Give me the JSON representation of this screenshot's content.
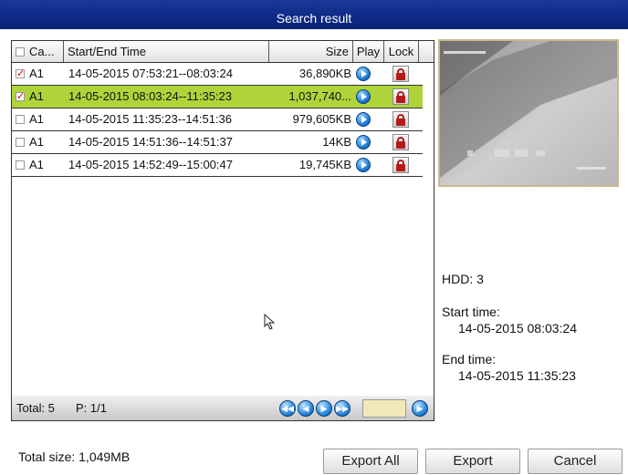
{
  "window": {
    "title": "Search result"
  },
  "table": {
    "headers": {
      "camera": "Ca...",
      "time": "Start/End Time",
      "size": "Size",
      "play": "Play",
      "lock": "Lock"
    },
    "rows": [
      {
        "checked": true,
        "camera": "A1",
        "time": "14-05-2015 07:53:21--08:03:24",
        "size": "36,890KB"
      },
      {
        "checked": true,
        "camera": "A1",
        "time": "14-05-2015 08:03:24--11:35:23",
        "size": "1,037,740..."
      },
      {
        "checked": false,
        "camera": "A1",
        "time": "14-05-2015 11:35:23--14:51:36",
        "size": "979,605KB"
      },
      {
        "checked": false,
        "camera": "A1",
        "time": "14-05-2015 14:51:36--14:51:37",
        "size": "14KB"
      },
      {
        "checked": false,
        "camera": "A1",
        "time": "14-05-2015 14:52:49--15:00:47",
        "size": "19,745KB"
      }
    ],
    "selected_row": 1
  },
  "footer": {
    "total": "Total: 5",
    "page": "P: 1/1"
  },
  "details": {
    "hdd": "HDD: 3",
    "start_label": "Start time:",
    "start_value": "14-05-2015 08:03:24",
    "end_label": "End time:",
    "end_value": "14-05-2015 11:35:23"
  },
  "bottom": {
    "total_size": "Total size: 1,049MB",
    "export_all": "Export All",
    "export": "Export",
    "cancel": "Cancel"
  },
  "colors": {
    "title_bar": "#0e2a86",
    "selected_row": "#aed43a",
    "page_input": "#f1e9b9"
  }
}
